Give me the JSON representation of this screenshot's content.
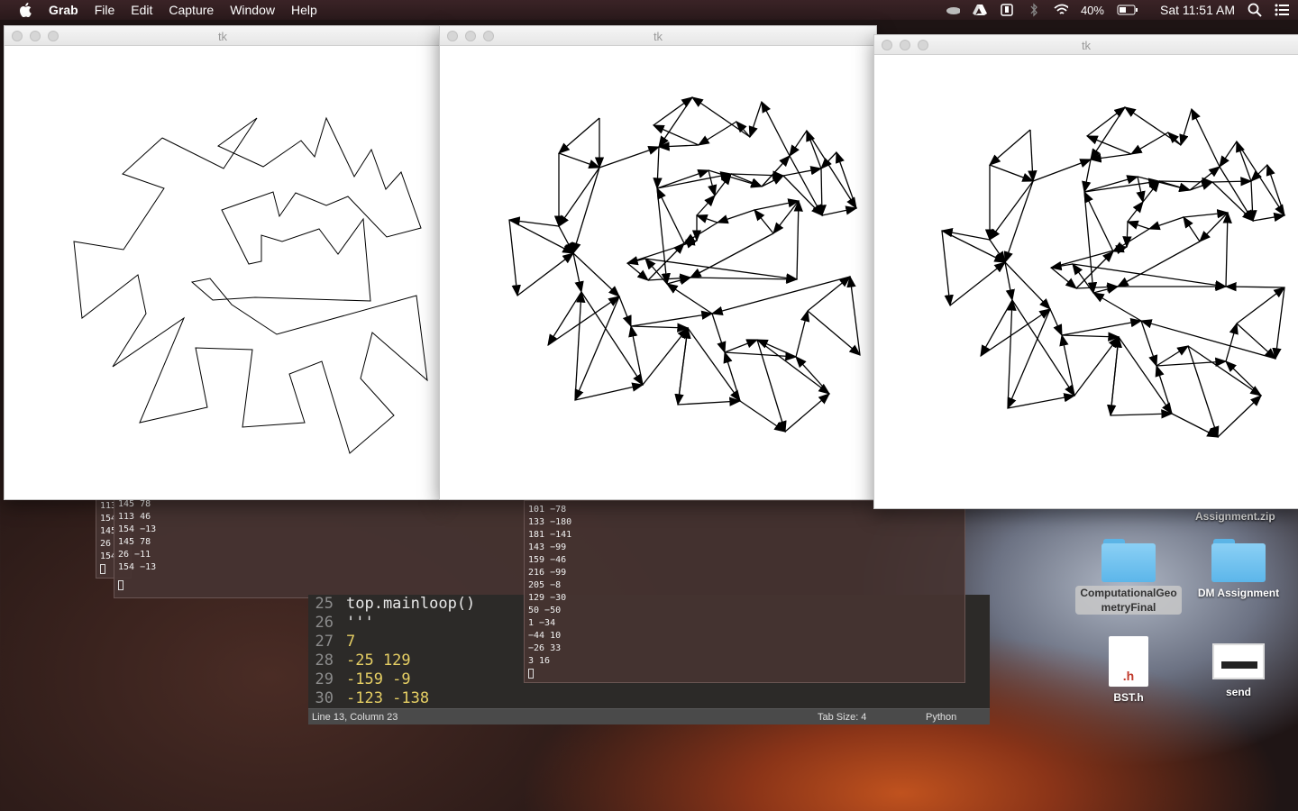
{
  "menubar": {
    "app_name": "Grab",
    "items": [
      "File",
      "Edit",
      "Capture",
      "Window",
      "Help"
    ],
    "battery": "40%",
    "clock": "Sat 11:51 AM"
  },
  "windows": [
    {
      "title": "tk"
    },
    {
      "title": "tk"
    },
    {
      "title": "tk"
    }
  ],
  "terminal_left_back": {
    "lines": [
      "113",
      "154",
      "145",
      "26",
      "154"
    ]
  },
  "terminal_left": {
    "lines": [
      "145 78",
      "113 46",
      "154 −13",
      "145 78",
      "26 −11",
      "154 −13"
    ]
  },
  "terminal_right": {
    "lines": [
      "101 −78",
      "133 −180",
      "181 −141",
      "143 −99",
      "159 −46",
      "216 −99",
      "205 −8",
      "129 −30",
      "50 −50",
      "1 −34",
      "−44 10",
      "−26 33",
      "3 16"
    ]
  },
  "editor": {
    "lines": [
      {
        "num": "25",
        "code": "top.mainloop()"
      },
      {
        "num": "26",
        "code": "'''"
      },
      {
        "num": "27",
        "code": "7"
      },
      {
        "num": "28",
        "code": "-25 129"
      },
      {
        "num": "29",
        "code": "-159 -9"
      },
      {
        "num": "30",
        "code": "-123 -138"
      }
    ],
    "status_position": "Line 13, Column 23",
    "status_tab": "Tab Size: 4",
    "status_lang": "Python"
  },
  "desktop": {
    "zip_label": "Assignment.zip",
    "folder1": "ComputationalGeometryFinal",
    "folder2": "DM Assignment",
    "file1": "BST.h",
    "file1_ext": ".h",
    "file2": "send"
  }
}
